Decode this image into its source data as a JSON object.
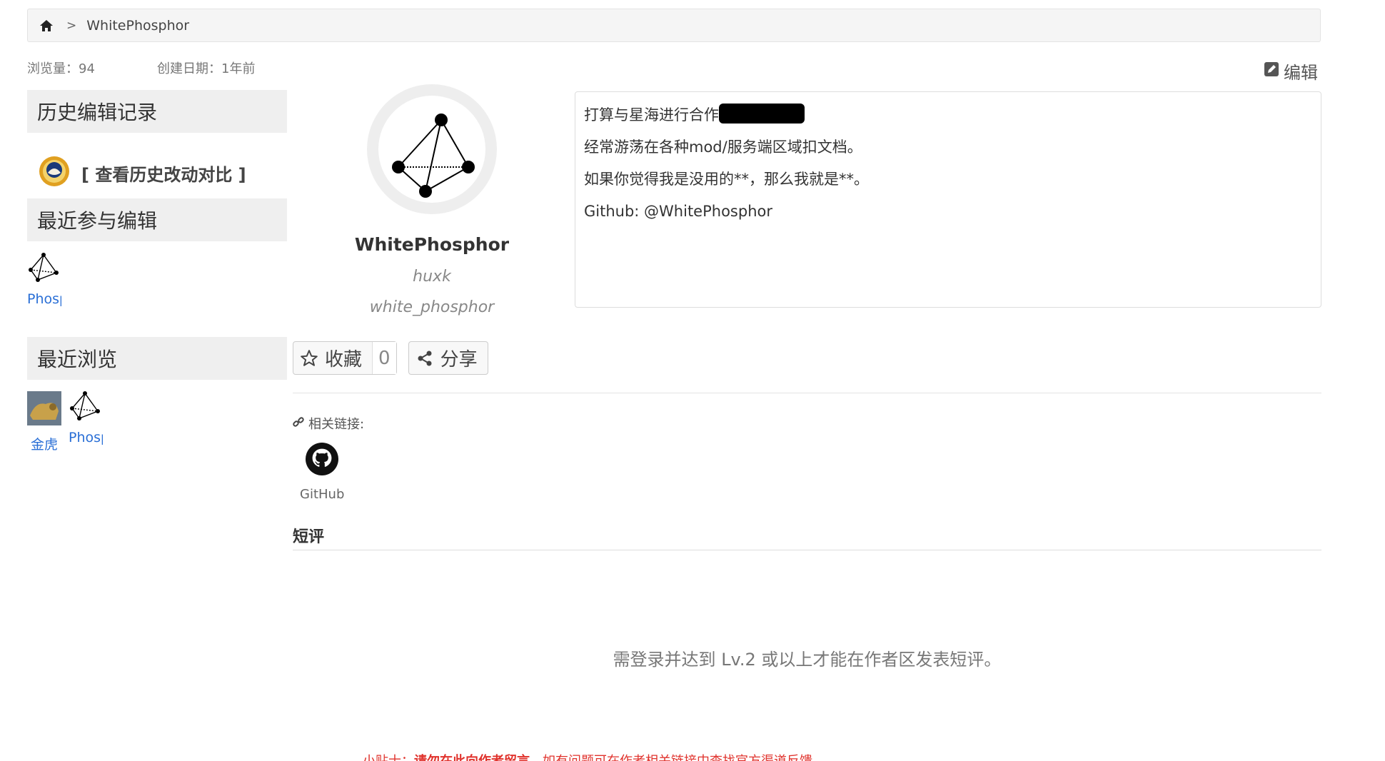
{
  "breadcrumb": {
    "home_icon": "home-icon",
    "separator": ">",
    "current": "WhitePhosphor"
  },
  "meta": {
    "views": "浏览量：94",
    "created": "创建日期：1年前"
  },
  "edit": {
    "icon": "edit-icon",
    "label": "编辑"
  },
  "sidebar": {
    "history_title": "历史编辑记录",
    "history_link": "[ 查看历史改动对比 ]",
    "recent_edit_title": "最近参与编辑",
    "recent_edit_items": [
      {
        "label": "Phosphor"
      }
    ],
    "recent_view_title": "最近浏览",
    "recent_view_items": [
      {
        "label": "金虎"
      },
      {
        "label": "Phosphor"
      }
    ]
  },
  "profile": {
    "name": "WhitePhosphor",
    "alias1": "huxk",
    "alias2": "white_phosphor"
  },
  "bio": {
    "line1": "打算与星海进行合作",
    "line2": "经常游荡在各种mod/服务端区域扣文档。",
    "line3": "如果你觉得我是没用的**，那么我就是**。",
    "line4": "Github: @WhitePhosphor"
  },
  "actions": {
    "favorite_label": "收藏",
    "favorite_count": "0",
    "share_label": "分享"
  },
  "related": {
    "title": "相关链接:",
    "github_label": "GitHub"
  },
  "short_review": {
    "title": "短评",
    "login_note": "需登录并达到 Lv.2 或以上才能在作者区发表短评。"
  },
  "tip": {
    "prefix": "小贴士：",
    "bold": "请勿在此向作者留言",
    "rest": "，如有问题可在作者相关链接中查找官方渠道反馈。"
  },
  "colors": {
    "link": "#2a6fd6",
    "tip": "#e0322c",
    "panel_bg": "#efefef"
  }
}
